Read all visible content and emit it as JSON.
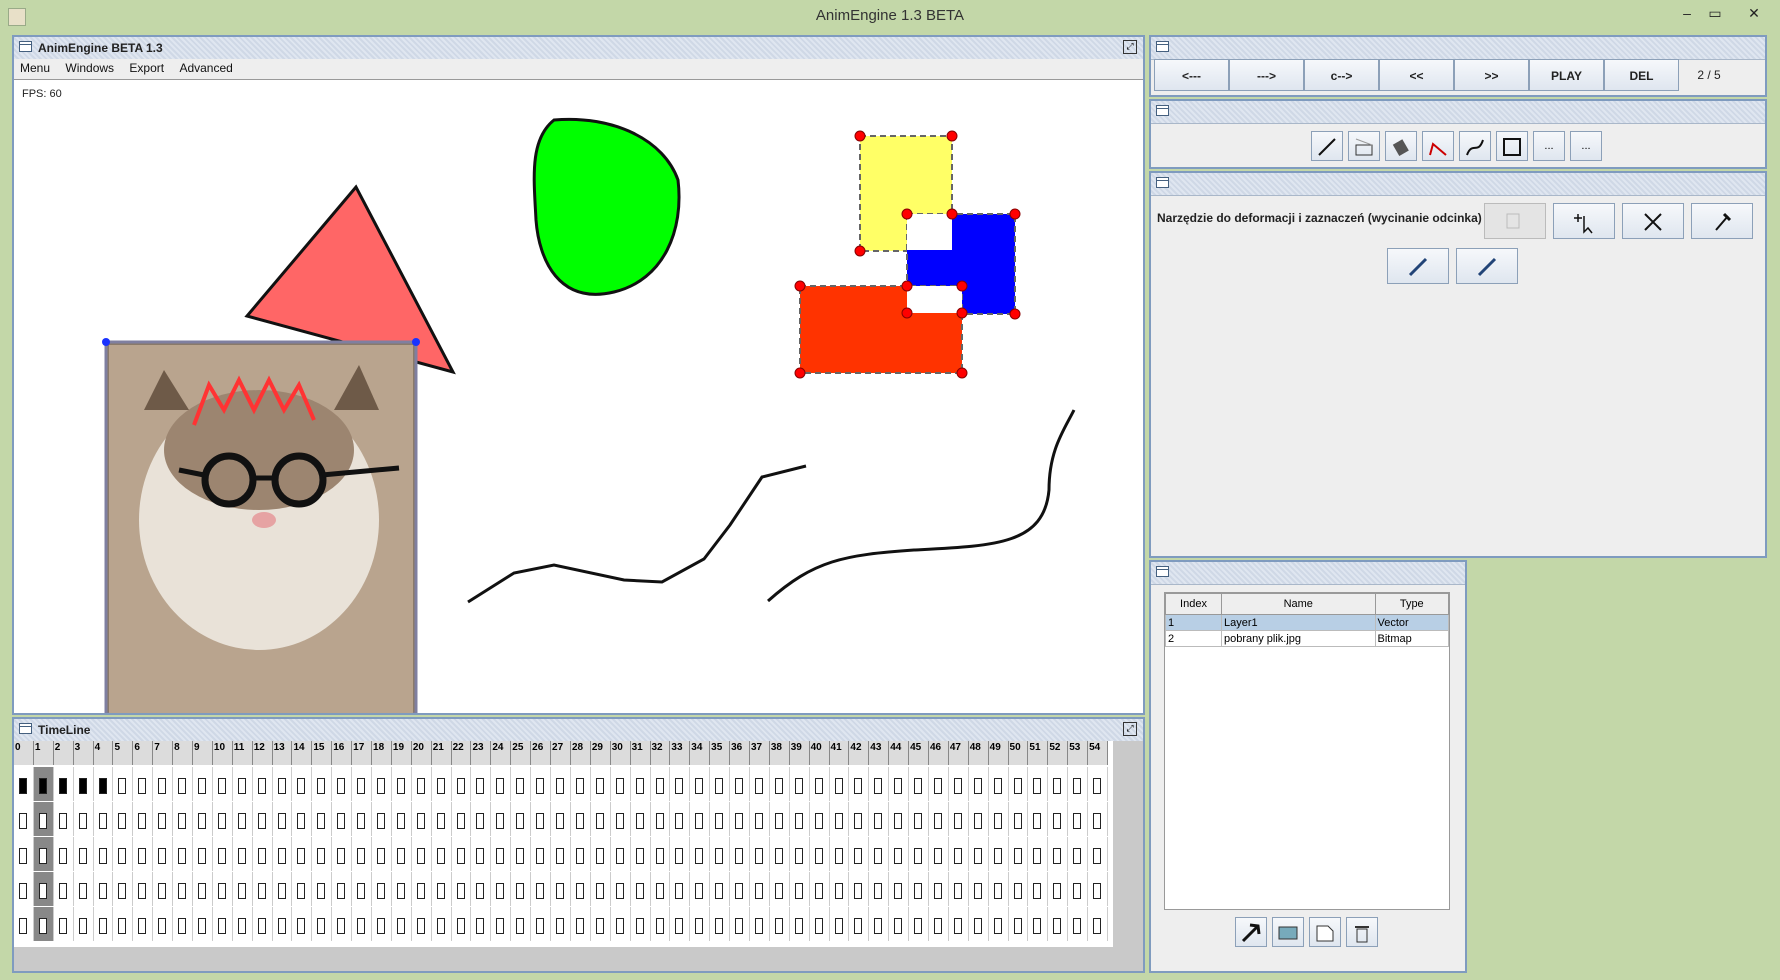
{
  "app": {
    "title": "AnimEngine 1.3 BETA"
  },
  "main_frame": {
    "title": "AnimEngine BETA 1.3",
    "menu": [
      "Menu",
      "Windows",
      "Export",
      "Advanced"
    ],
    "fps": "FPS: 60"
  },
  "nav_panel": {
    "buttons": [
      "<---",
      "--->",
      "c-->",
      "<<",
      ">>",
      "PLAY",
      "DEL"
    ],
    "page": "2 / 5"
  },
  "tools_panel": {
    "tools": [
      "line-tool-icon",
      "bitmap-tool-icon",
      "fill-tool-icon",
      "pen-tool-icon",
      "curve-tool-icon",
      "rectangle-tool-icon",
      "...",
      "..."
    ]
  },
  "deform_panel": {
    "label": "Narzędzie do deformacji i zaznaczeń (wycinanie odcinka)"
  },
  "layers_panel": {
    "columns": [
      "Index",
      "Name",
      "Type"
    ],
    "rows": [
      {
        "index": "1",
        "name": "Layer1",
        "type": "Vector"
      },
      {
        "index": "2",
        "name": "pobrany plik.jpg",
        "type": "Bitmap"
      }
    ]
  },
  "timeline": {
    "title": "TimeLine",
    "frames": [
      "0",
      "1",
      "2",
      "3",
      "4",
      "5",
      "6",
      "7",
      "8",
      "9",
      "10",
      "11",
      "12",
      "13",
      "14",
      "15",
      "16",
      "17",
      "18",
      "19",
      "20",
      "21",
      "22",
      "23",
      "24",
      "25",
      "26",
      "27",
      "28",
      "29",
      "30",
      "31",
      "32",
      "33",
      "34",
      "35",
      "36",
      "37",
      "38",
      "39",
      "40",
      "41",
      "42",
      "43",
      "44",
      "45",
      "46",
      "47",
      "48",
      "49",
      "50",
      "51",
      "52",
      "53",
      "54"
    ]
  },
  "colors": {
    "accent": "#7f9bbf",
    "selection": "#b8cfe5"
  }
}
